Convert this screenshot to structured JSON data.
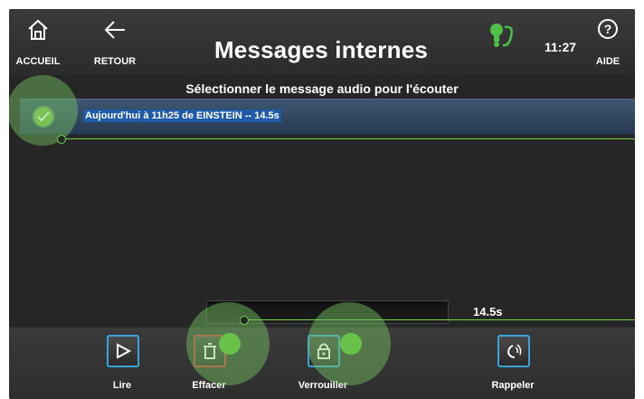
{
  "header": {
    "home_label": "ACCUEIL",
    "back_label": "RETOUR",
    "title": "Messages internes",
    "time": "11:27",
    "help_label": "AIDE"
  },
  "content": {
    "instruction": "Sélectionner le message audio pour l'écouter",
    "messages": [
      {
        "label": "Aujourd'hui à 11h25  de EINSTEIN  -- 14.5s",
        "selected": true
      }
    ]
  },
  "playback": {
    "duration": "14.5s",
    "progress_fraction": 0.0
  },
  "toolbar": {
    "play_label": "Lire",
    "delete_label": "Effacer",
    "lock_label": "Verrouiller",
    "callback_label": "Rappeler"
  },
  "colors": {
    "accent_blue": "#3aa3d8",
    "delete_red": "#d23a3a",
    "touch_green": "#68c24a",
    "selection_bg": "#2f4763"
  },
  "icons": [
    "home-icon",
    "back-arrow-icon",
    "phone-status-icon",
    "help-icon",
    "check-icon",
    "play-icon",
    "trash-icon",
    "lock-icon",
    "callback-icon"
  ]
}
